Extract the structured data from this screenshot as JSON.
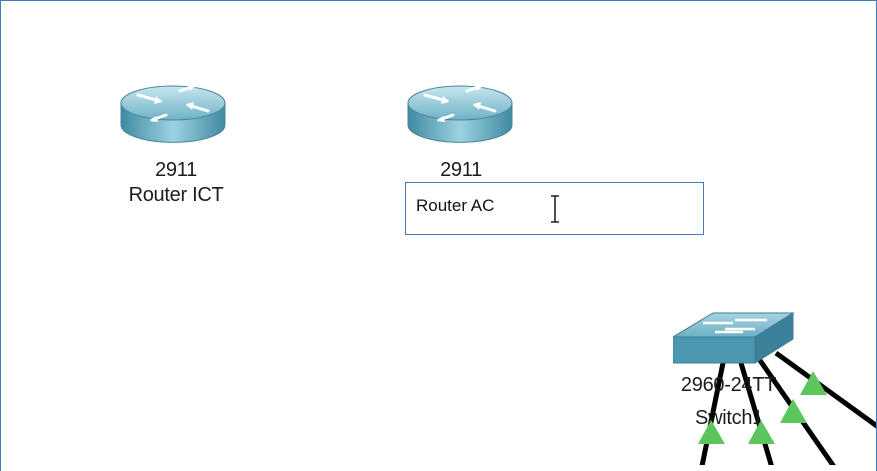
{
  "devices": [
    {
      "model": "2911",
      "name": "Router ICT",
      "type": "router"
    },
    {
      "model": "2911",
      "name": "Router AC",
      "type": "router",
      "editing": true
    },
    {
      "model": "2960-24TT",
      "name": "Switch1",
      "type": "switch"
    }
  ],
  "rename_field": {
    "value": "Router AC"
  },
  "icons": {
    "router": "router-icon",
    "switch": "switch-icon",
    "link_status": "link-up-triangle-icon",
    "cursor": "text-cursor-icon"
  },
  "colors": {
    "canvas_border": "#3d7ebd",
    "router_body": "#5fa6bd",
    "link_up": "#5cc55c",
    "cable": "#000000"
  }
}
